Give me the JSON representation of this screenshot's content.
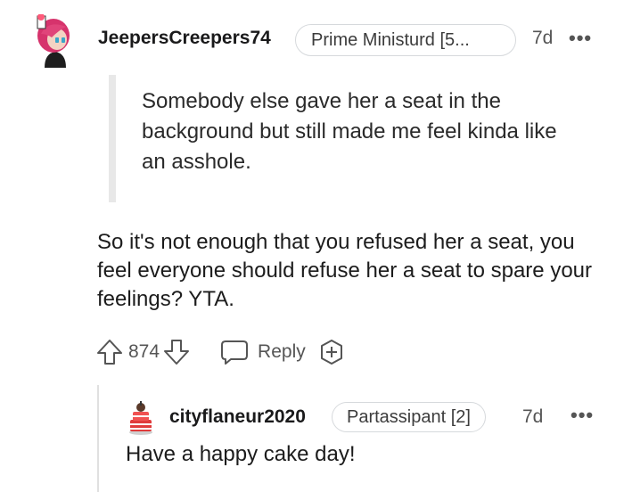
{
  "comment": {
    "username": "JeepersCreepers74",
    "flair": "Prime Ministurd [5...",
    "time": "7d",
    "more": "•••",
    "quote": "Somebody else gave her a seat in the background but still made me feel kinda like an asshole.",
    "body": "So it's not enough that you refused her a seat, you feel everyone should refuse her a seat to spare your feelings? YTA.",
    "votes": "874",
    "reply_label": "Reply",
    "icons": [
      "avatar",
      "upvote-icon",
      "downvote-icon",
      "comment-icon",
      "award-icon"
    ]
  },
  "reply": {
    "username": "cityflaneur2020",
    "flair": "Partassipant [2]",
    "time": "7d",
    "more": "•••",
    "body": "Have a happy cake day!",
    "icons": [
      "avatar",
      "cake-icon"
    ]
  },
  "colors": {
    "text": "#1c1c1c",
    "muted": "#555555",
    "quote_bar": "#e8e8e8",
    "avatar_hair": "#d6336c"
  }
}
